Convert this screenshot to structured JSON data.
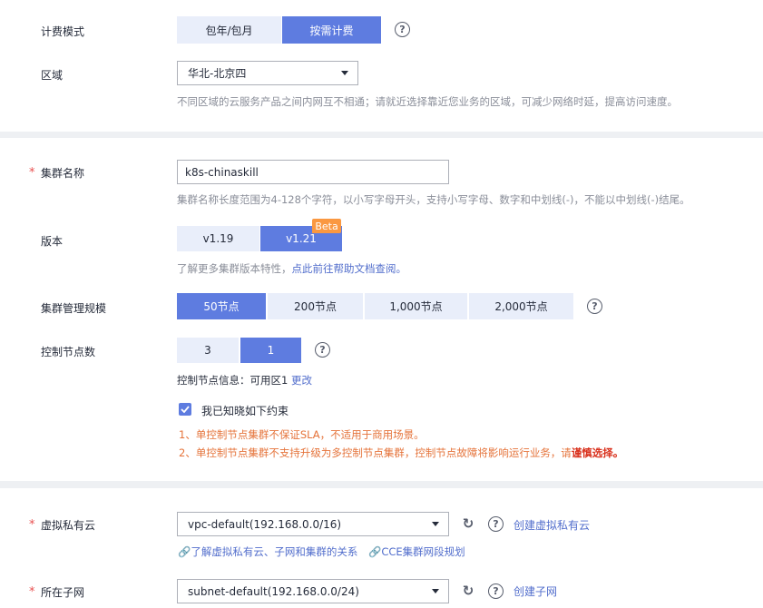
{
  "billing": {
    "label": "计费模式",
    "options": [
      "包年/包月",
      "按需计费"
    ],
    "selected": "按需计费"
  },
  "region": {
    "label": "区域",
    "value": "华北-北京四",
    "hint": "不同区域的云服务产品之间内网互不相通；请就近选择靠近您业务的区域，可减少网络时延，提高访问速度。"
  },
  "cluster_name": {
    "required": "*",
    "label": "集群名称",
    "value": "k8s-chinaskill",
    "hint": "集群名称长度范围为4-128个字符，以小写字母开头，支持小写字母、数字和中划线(-)，不能以中划线(-)结尾。"
  },
  "version": {
    "label": "版本",
    "options": [
      "v1.19",
      "v1.21"
    ],
    "selected": "v1.21",
    "badge": "Beta",
    "hint_prefix": "了解更多集群版本特性，",
    "hint_link": "点此前往帮助文档查阅。"
  },
  "scale": {
    "label": "集群管理规模",
    "options": [
      "50节点",
      "200节点",
      "1,000节点",
      "2,000节点"
    ],
    "selected": "50节点"
  },
  "control_nodes": {
    "label": "控制节点数",
    "options": [
      "3",
      "1"
    ],
    "selected": "1",
    "info_prefix": "控制节点信息：可用区1",
    "info_link": "更改",
    "ack_label": "我已知晓如下约束",
    "ack_checked": true,
    "warn1": "1、单控制节点集群不保证SLA，不适用于商用场景。",
    "warn2_prefix": "2、单控制节点集群不支持升级为多控制节点集群，控制节点故障将影响运行业务，请",
    "warn2_emph": "谨慎选择。"
  },
  "vpc": {
    "required": "*",
    "label": "虚拟私有云",
    "value": "vpc-default(192.168.0.0/16)",
    "create_link": "创建虚拟私有云",
    "help_link1": "了解虚拟私有云、子网和集群的关系",
    "help_link2": "CCE集群网段规划"
  },
  "subnet": {
    "required": "*",
    "label": "所在子网",
    "value": "subnet-default(192.168.0.0/24)",
    "create_link": "创建子网"
  },
  "colors": {
    "primary": "#5e7ce0",
    "segment_off": "#e9eefa",
    "link": "#526ecc",
    "warning": "#e5733a",
    "badge": "#fa9841",
    "required": "#e84f4f"
  }
}
